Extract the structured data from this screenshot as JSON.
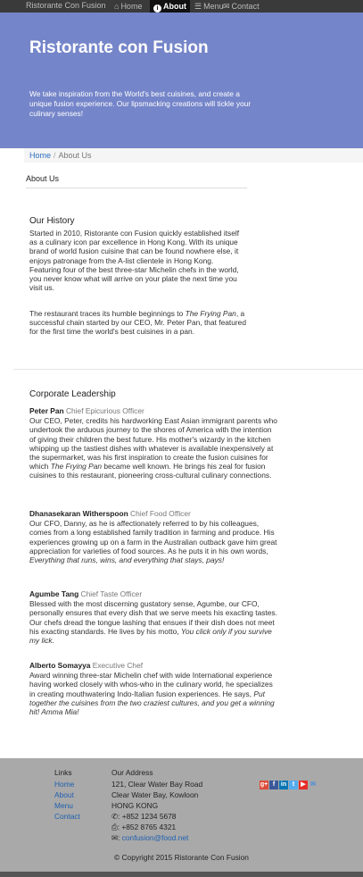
{
  "nav": {
    "brand": "Ristorante Con Fusion",
    "home": "Home",
    "about": "About",
    "menu": "Menu",
    "contact": "Contact"
  },
  "hero": {
    "title": "Ristorante con Fusion",
    "tagline": "We take inspiration from the World's best cuisines, and create a unique fusion experience. Our lipsmacking creations will tickle your culinary senses!"
  },
  "breadcrumb": {
    "home": "Home",
    "separator": "/",
    "current": "About Us"
  },
  "page_title": "About Us",
  "history": {
    "heading": "Our History",
    "p1": "Started in 2010, Ristorante con Fusion quickly established itself as a culinary icon par excellence in Hong Kong. With its unique brand of world fusion cuisine that can be found nowhere else, it enjoys patronage from the A-list clientele in Hong Kong. Featuring four of the best three-star Michelin chefs in the world, you never know what will arrive on your plate the next time you visit us.",
    "p2_a": "The restaurant traces its humble beginnings to ",
    "p2_em": "The Frying Pan",
    "p2_b": ", a successful chain started by our CEO, Mr. Peter Pan, that featured for the first time the world's best cuisines in a pan."
  },
  "leadership": {
    "heading": "Corporate Leadership",
    "leaders": [
      {
        "name": "Peter Pan",
        "role": "Chief Epicurious Officer",
        "bio_a": "Our CEO, Peter, credits his hardworking East Asian immigrant parents who undertook the arduous journey to the shores of America with the intention of giving their children the best future. His mother's wizardy in the kitchen whipping up the tastiest dishes with whatever is available inexpensively at the supermarket, was his first inspiration to create the fusion cuisines for which ",
        "bio_em": "The Frying Pan",
        "bio_b": " became well known. He brings his zeal for fusion cuisines to this restaurant, pioneering cross-cultural culinary connections."
      },
      {
        "name": "Dhanasekaran Witherspoon",
        "role": "Chief Food Officer",
        "bio_a": "Our CFO, Danny, as he is affectionately referred to by his colleagues, comes from a long established family tradition in farming and produce. His experiences growing up on a farm in the Australian outback gave him great appreciation for varieties of food sources. As he puts it in his own words, ",
        "bio_em": "Everything that runs, wins, and everything that stays, pays!",
        "bio_b": ""
      },
      {
        "name": "Agumbe Tang",
        "role": "Chief Taste Officer",
        "bio_a": "Blessed with the most discerning gustatory sense, Agumbe, our CFO, personally ensures that every dish that we serve meets his exacting tastes. Our chefs dread the tongue lashing that ensues if their dish does not meet his exacting standards. He lives by his motto, ",
        "bio_em": "You click only if you survive my lick.",
        "bio_b": ""
      },
      {
        "name": "Alberto Somayya",
        "role": "Executive Chef",
        "bio_a": "Award winning three-star Michelin chef with wide International experience having worked closely with whos-who in the culinary world, he specializes in creating mouthwatering Indo-Italian fusion experiences. He says, ",
        "bio_em": "Put together the cuisines from the two craziest cultures, and you get a winning hit! Amma Mia!",
        "bio_b": ""
      }
    ]
  },
  "footer": {
    "links_title": "Links",
    "links": [
      "Home",
      "About",
      "Menu",
      "Contact"
    ],
    "address_title": "Our Address",
    "address_lines": [
      "121, Clear Water Bay Road",
      "Clear Water Bay, Kowloon",
      "HONG KONG"
    ],
    "phone": "+852 1234 5678",
    "fax": "+852 8765 4321",
    "email": "confusion@food.net",
    "social_icons": [
      "google-plus-icon",
      "facebook-icon",
      "linkedin-icon",
      "twitter-icon",
      "youtube-icon",
      "mail-icon"
    ],
    "social_colors": [
      "#dd4b39",
      "#3b5998",
      "#0976b4",
      "#55acee",
      "#e52d27",
      "#4a90d9"
    ],
    "copyright": "© Copyright 2015 Ristorante Con Fusion"
  }
}
